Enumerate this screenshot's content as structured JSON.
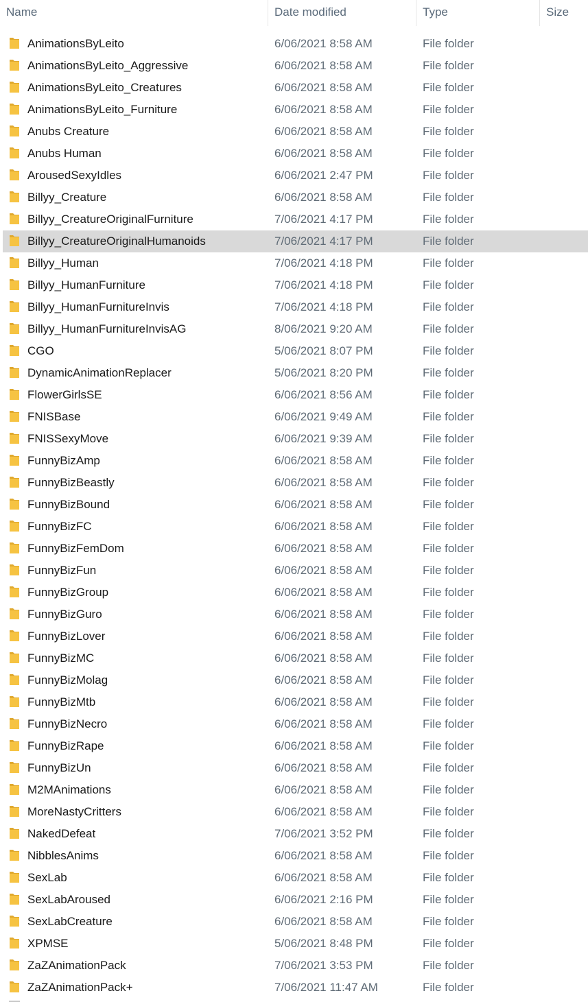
{
  "columns": {
    "name": "Name",
    "date": "Date modified",
    "type": "Type",
    "size": "Size"
  },
  "sort_indicator": "^",
  "folder_icon": "folder-icon",
  "colors": {
    "folder": "#f6c342",
    "folder_dark": "#e0a92e",
    "selection": "#d9d9d9",
    "header_text": "#5a6a7a"
  },
  "selected_index": 9,
  "files": [
    {
      "name": "AnimationsByLeito",
      "date": "6/06/2021 8:58 AM",
      "type": "File folder"
    },
    {
      "name": "AnimationsByLeito_Aggressive",
      "date": "6/06/2021 8:58 AM",
      "type": "File folder"
    },
    {
      "name": "AnimationsByLeito_Creatures",
      "date": "6/06/2021 8:58 AM",
      "type": "File folder"
    },
    {
      "name": "AnimationsByLeito_Furniture",
      "date": "6/06/2021 8:58 AM",
      "type": "File folder"
    },
    {
      "name": "Anubs Creature",
      "date": "6/06/2021 8:58 AM",
      "type": "File folder"
    },
    {
      "name": "Anubs Human",
      "date": "6/06/2021 8:58 AM",
      "type": "File folder"
    },
    {
      "name": "ArousedSexyIdles",
      "date": "6/06/2021 2:47 PM",
      "type": "File folder"
    },
    {
      "name": "Billyy_Creature",
      "date": "6/06/2021 8:58 AM",
      "type": "File folder"
    },
    {
      "name": "Billyy_CreatureOriginalFurniture",
      "date": "7/06/2021 4:17 PM",
      "type": "File folder"
    },
    {
      "name": "Billyy_CreatureOriginalHumanoids",
      "date": "7/06/2021 4:17 PM",
      "type": "File folder"
    },
    {
      "name": "Billyy_Human",
      "date": "7/06/2021 4:18 PM",
      "type": "File folder"
    },
    {
      "name": "Billyy_HumanFurniture",
      "date": "7/06/2021 4:18 PM",
      "type": "File folder"
    },
    {
      "name": "Billyy_HumanFurnitureInvis",
      "date": "7/06/2021 4:18 PM",
      "type": "File folder"
    },
    {
      "name": "Billyy_HumanFurnitureInvisAG",
      "date": "8/06/2021 9:20 AM",
      "type": "File folder"
    },
    {
      "name": "CGO",
      "date": "5/06/2021 8:07 PM",
      "type": "File folder"
    },
    {
      "name": "DynamicAnimationReplacer",
      "date": "5/06/2021 8:20 PM",
      "type": "File folder"
    },
    {
      "name": "FlowerGirlsSE",
      "date": "6/06/2021 8:56 AM",
      "type": "File folder"
    },
    {
      "name": "FNISBase",
      "date": "6/06/2021 9:49 AM",
      "type": "File folder"
    },
    {
      "name": "FNISSexyMove",
      "date": "6/06/2021 9:39 AM",
      "type": "File folder"
    },
    {
      "name": "FunnyBizAmp",
      "date": "6/06/2021 8:58 AM",
      "type": "File folder"
    },
    {
      "name": "FunnyBizBeastly",
      "date": "6/06/2021 8:58 AM",
      "type": "File folder"
    },
    {
      "name": "FunnyBizBound",
      "date": "6/06/2021 8:58 AM",
      "type": "File folder"
    },
    {
      "name": "FunnyBizFC",
      "date": "6/06/2021 8:58 AM",
      "type": "File folder"
    },
    {
      "name": "FunnyBizFemDom",
      "date": "6/06/2021 8:58 AM",
      "type": "File folder"
    },
    {
      "name": "FunnyBizFun",
      "date": "6/06/2021 8:58 AM",
      "type": "File folder"
    },
    {
      "name": "FunnyBizGroup",
      "date": "6/06/2021 8:58 AM",
      "type": "File folder"
    },
    {
      "name": "FunnyBizGuro",
      "date": "6/06/2021 8:58 AM",
      "type": "File folder"
    },
    {
      "name": "FunnyBizLover",
      "date": "6/06/2021 8:58 AM",
      "type": "File folder"
    },
    {
      "name": "FunnyBizMC",
      "date": "6/06/2021 8:58 AM",
      "type": "File folder"
    },
    {
      "name": "FunnyBizMolag",
      "date": "6/06/2021 8:58 AM",
      "type": "File folder"
    },
    {
      "name": "FunnyBizMtb",
      "date": "6/06/2021 8:58 AM",
      "type": "File folder"
    },
    {
      "name": "FunnyBizNecro",
      "date": "6/06/2021 8:58 AM",
      "type": "File folder"
    },
    {
      "name": "FunnyBizRape",
      "date": "6/06/2021 8:58 AM",
      "type": "File folder"
    },
    {
      "name": "FunnyBizUn",
      "date": "6/06/2021 8:58 AM",
      "type": "File folder"
    },
    {
      "name": "M2MAnimations",
      "date": "6/06/2021 8:58 AM",
      "type": "File folder"
    },
    {
      "name": "MoreNastyCritters",
      "date": "6/06/2021 8:58 AM",
      "type": "File folder"
    },
    {
      "name": "NakedDefeat",
      "date": "7/06/2021 3:52 PM",
      "type": "File folder"
    },
    {
      "name": "NibblesAnims",
      "date": "6/06/2021 8:58 AM",
      "type": "File folder"
    },
    {
      "name": "SexLab",
      "date": "6/06/2021 8:58 AM",
      "type": "File folder"
    },
    {
      "name": "SexLabAroused",
      "date": "6/06/2021 2:16 PM",
      "type": "File folder"
    },
    {
      "name": "SexLabCreature",
      "date": "6/06/2021 8:58 AM",
      "type": "File folder"
    },
    {
      "name": "XPMSE",
      "date": "5/06/2021 8:48 PM",
      "type": "File folder"
    },
    {
      "name": "ZaZAnimationPack",
      "date": "7/06/2021 3:53 PM",
      "type": "File folder"
    },
    {
      "name": "ZaZAnimationPack+",
      "date": "7/06/2021 11:47 AM",
      "type": "File folder"
    }
  ]
}
